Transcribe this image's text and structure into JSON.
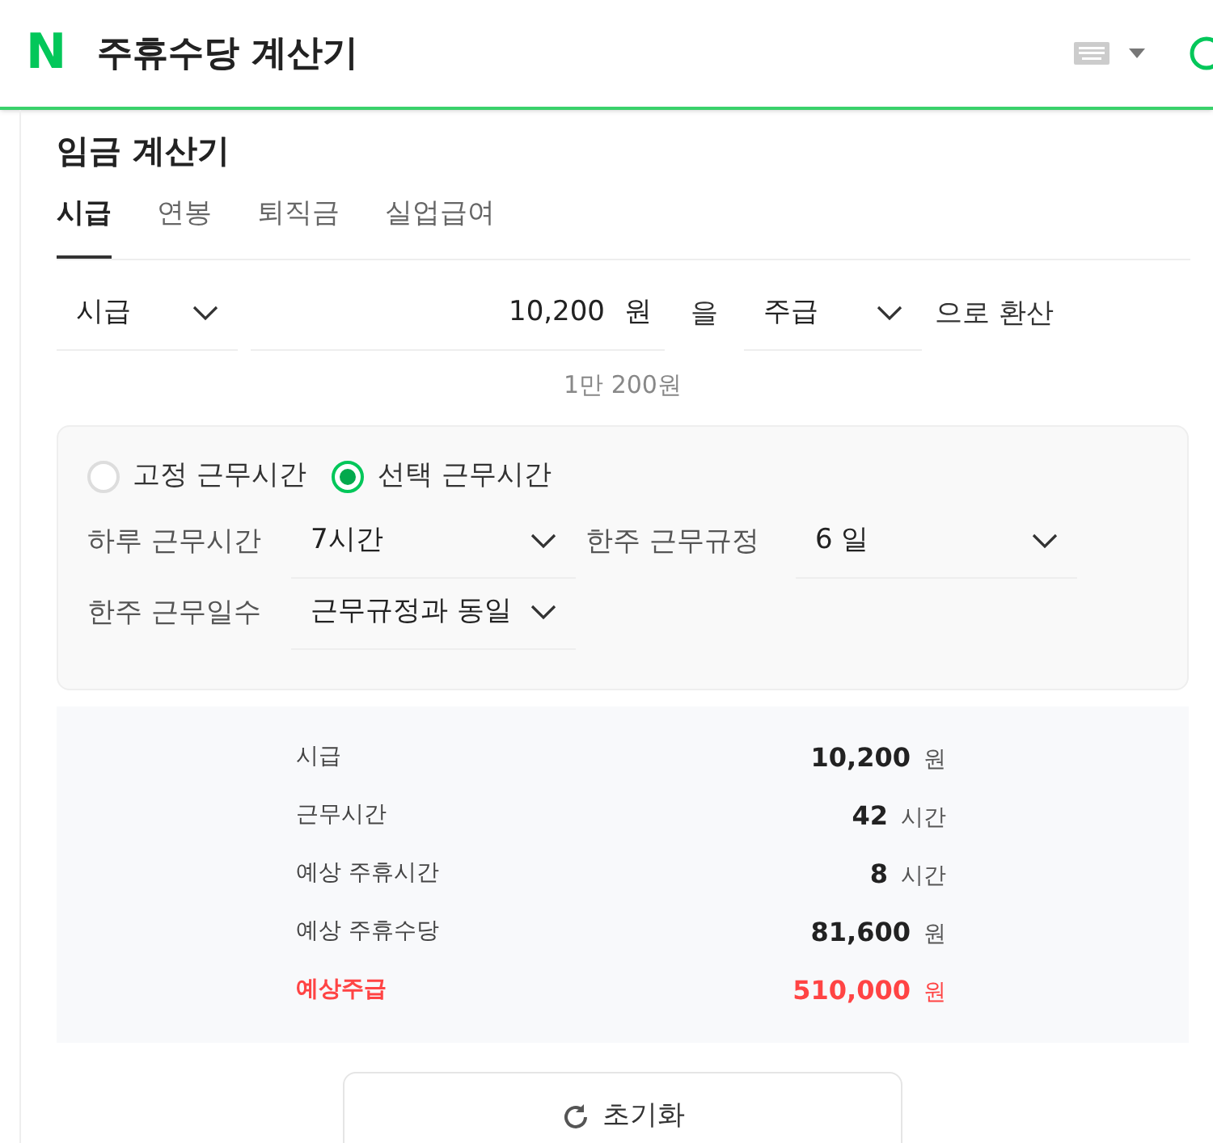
{
  "header": {
    "logo": "N",
    "title": "주휴수당 계산기"
  },
  "card": {
    "title": "임금 계산기",
    "tabs": [
      {
        "label": "시급",
        "selected": true
      },
      {
        "label": "연봉",
        "selected": false
      },
      {
        "label": "퇴직금",
        "selected": false
      },
      {
        "label": "실업급여",
        "selected": false
      }
    ],
    "conversion": {
      "from": "시급",
      "amount": "10,200",
      "unit": "원",
      "particle": "을",
      "to": "주급",
      "suffix": "으로 환산",
      "hint": "1만 200원"
    },
    "options": {
      "modes": [
        {
          "label": "고정 근무시간",
          "selected": false
        },
        {
          "label": "선택 근무시간",
          "selected": true
        }
      ],
      "fields": [
        {
          "label": "하루 근무시간",
          "value": "7시간"
        },
        {
          "label": "한주 근무규정",
          "value": "6 일"
        },
        {
          "label": "한주 근무일수",
          "value": "근무규정과 동일"
        }
      ]
    },
    "results": [
      {
        "label": "시급",
        "value": "10,200",
        "unit": "원",
        "highlight": false
      },
      {
        "label": "근무시간",
        "value": "42",
        "unit": "시간",
        "highlight": false
      },
      {
        "label": "예상 주휴시간",
        "value": "8",
        "unit": "시간",
        "highlight": false
      },
      {
        "label": "예상 주휴수당",
        "value": "81,600",
        "unit": "원",
        "highlight": false
      },
      {
        "label": "예상주급",
        "value": "510,000",
        "unit": "원",
        "highlight": true
      }
    ],
    "reset_button": "초기화"
  }
}
